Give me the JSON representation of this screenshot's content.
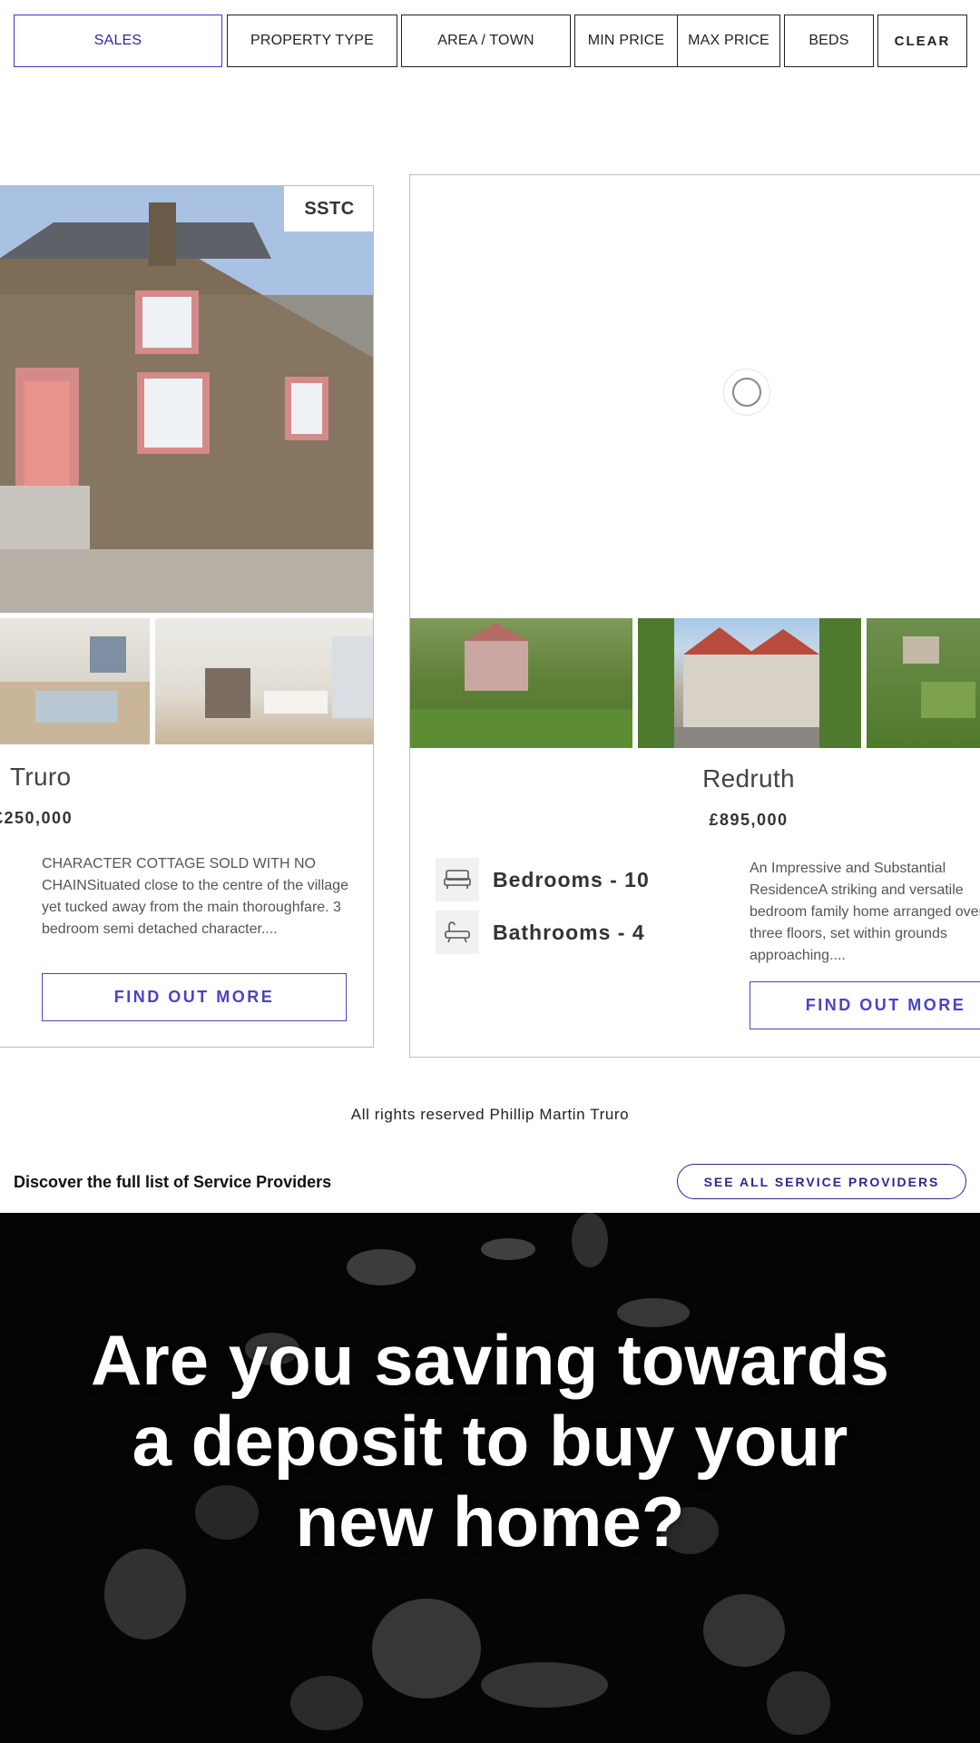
{
  "filters": {
    "sales": "SALES",
    "property_type": "PROPERTY TYPE",
    "area_town": "AREA / TOWN",
    "min_price": "MIN PRICE",
    "max_price": "MAX PRICE",
    "beds": "BEDS",
    "clear": "CLEAR"
  },
  "listings": [
    {
      "badge": "SSTC",
      "town": "Truro",
      "price": "£250,000",
      "description": "CHARACTER COTTAGE SOLD WITH NO CHAINSituated close to the centre of the village yet tucked away from the main thoroughfare. 3 bedroom semi detached character....",
      "cta": "FIND OUT MORE"
    },
    {
      "town": "Redruth",
      "price": "£895,000",
      "bedrooms": "Bedrooms - 10",
      "bathrooms": "Bathrooms - 4",
      "description": "An Impressive and Substantial ResidenceA striking and versatile bedroom family home arranged over three floors, set within grounds approaching....",
      "cta": "FIND OUT MORE"
    }
  ],
  "footer": {
    "copyright": "All rights reserved Phillip Martin Truro"
  },
  "providers": {
    "text": "Discover the full list of Service Providers",
    "button": "SEE ALL SERVICE PROVIDERS"
  },
  "hero": {
    "title": "Are you saving towards a deposit to buy your new home?"
  },
  "colors": {
    "accent": "#4a44c4",
    "provider_accent": "#2a2a8e",
    "hero_bg": "#050505"
  }
}
